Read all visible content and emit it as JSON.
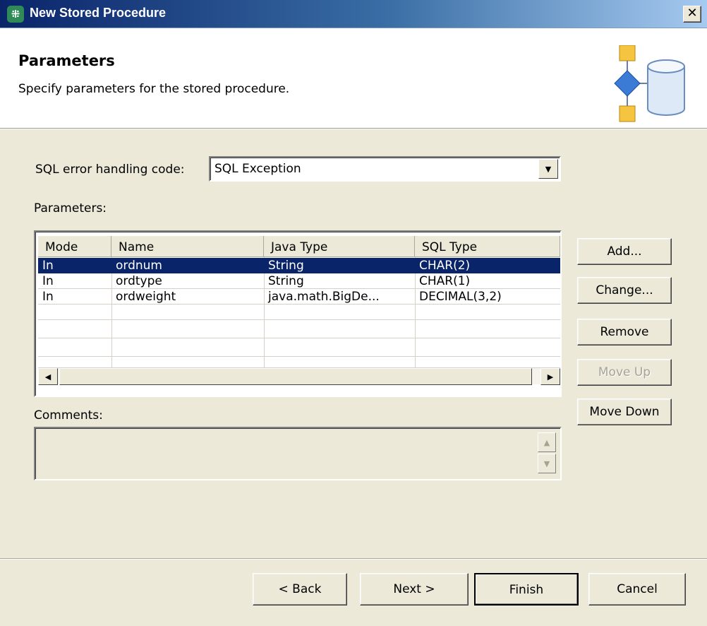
{
  "window": {
    "title": "New Stored Procedure",
    "close_glyph": "✕"
  },
  "header": {
    "title": "Parameters",
    "subtitle": "Specify parameters for the stored procedure.",
    "icon": "stored-procedure-wizard-icon"
  },
  "sql_error": {
    "label": "SQL error handling code:",
    "value": "SQL Exception"
  },
  "parameters": {
    "label": "Parameters:",
    "columns": [
      "Mode",
      "Name",
      "Java Type",
      "SQL Type"
    ],
    "rows": [
      {
        "mode": "In",
        "name": "ordnum",
        "java_type": "String",
        "sql_type": "CHAR(2)",
        "selected": true
      },
      {
        "mode": "In",
        "name": "ordtype",
        "java_type": "String",
        "sql_type": "CHAR(1)"
      },
      {
        "mode": "In",
        "name": "ordweight",
        "java_type": "java.math.BigDe...",
        "sql_type": "DECIMAL(3,2)"
      }
    ]
  },
  "side_buttons": {
    "add": "Add...",
    "change": "Change...",
    "remove": "Remove",
    "move_up": "Move Up",
    "move_down": "Move Down"
  },
  "comments": {
    "label": "Comments:",
    "value": ""
  },
  "footer": {
    "back": "< Back",
    "next": "Next >",
    "finish": "Finish",
    "cancel": "Cancel"
  },
  "colors": {
    "selection": "#0a246a",
    "dialog_bg": "#ece9d8",
    "titlebar_start": "#0a246a"
  }
}
